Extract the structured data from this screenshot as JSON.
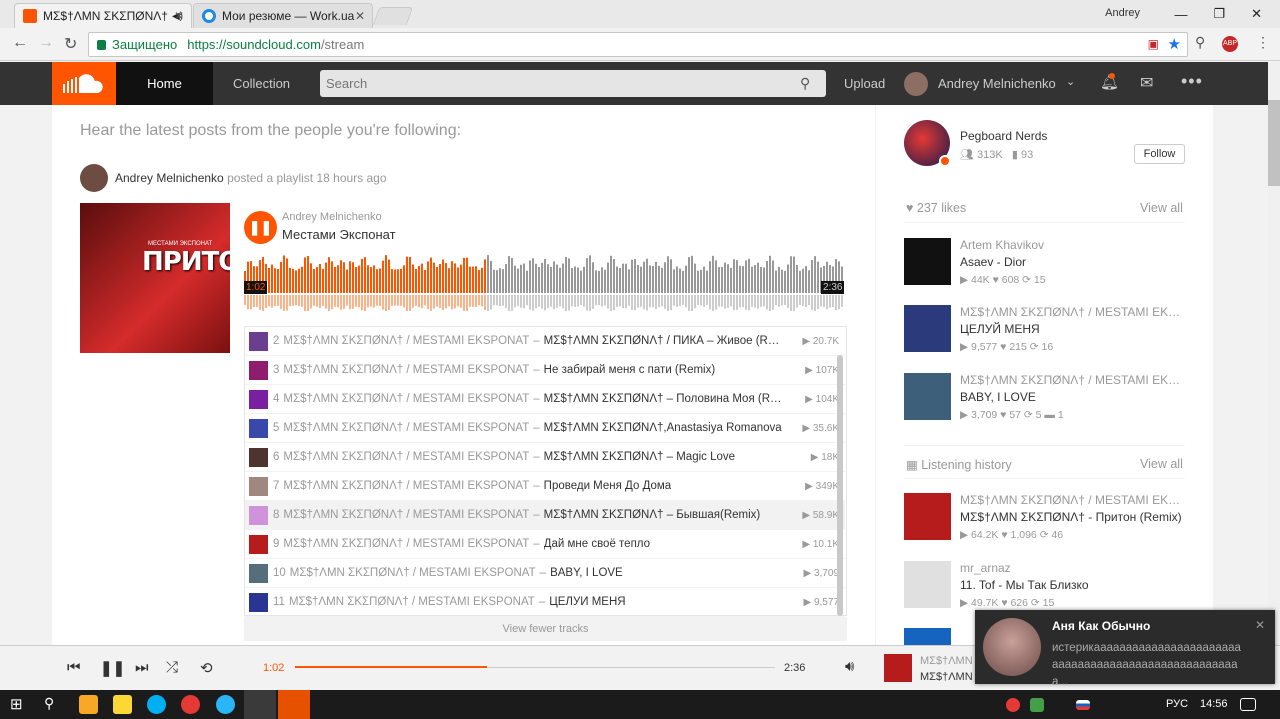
{
  "browser": {
    "tabs": [
      {
        "title": "ΜΣ$†ΛΜΝ ΣΚΣΠØΝΛ†",
        "active": true
      },
      {
        "title": "Мои резюме — Work.ua",
        "active": false
      }
    ],
    "user": "Andrey",
    "secure_label": "Защищено",
    "url_host": "https://soundcloud.com",
    "url_path": "/stream"
  },
  "header": {
    "nav": [
      "Home",
      "Collection"
    ],
    "search_placeholder": "Search",
    "upload": "Upload",
    "username": "Andrey Melnichenko"
  },
  "stream": {
    "intro": "Hear the latest posts from the people you're following:",
    "poster": "Andrey Melnichenko",
    "posted_suffix": "posted a playlist 18 hours ago",
    "playlist": {
      "user": "Andrey Melnichenko",
      "title": "Местами Экспонат",
      "current_time": "1:02",
      "duration": "2:36",
      "progress": 0.4,
      "art_title": "ПРИТОН",
      "art_subtitle": "МЕСТАМИ ЭКСПОНАТ"
    },
    "tracks": [
      {
        "n": "2",
        "artist": "ΜΣ$†ΛΜΝ ΣΚΣΠØΝΛ† / MESTAMI EKSPONAT",
        "title": "ΜΣ$†ΛΜΝ ΣΚΣΠØΝΛ† / ПИКА – Живое (Remix)",
        "plays": "20.7K",
        "color": "#6a3f8f"
      },
      {
        "n": "3",
        "artist": "ΜΣ$†ΛΜΝ ΣΚΣΠØΝΛ† / MESTAMI EKSPONAT",
        "title": "Не забирай меня с пати (Remix)",
        "plays": "107K",
        "color": "#8e1d6e"
      },
      {
        "n": "4",
        "artist": "ΜΣ$†ΛΜΝ ΣΚΣΠØΝΛ† / MESTAMI EKSPONAT",
        "title": "ΜΣ$†ΛΜΝ ΣΚΣΠØΝΛ† – Половина Моя (Remix)",
        "plays": "104K",
        "color": "#7b1fa2"
      },
      {
        "n": "5",
        "artist": "ΜΣ$†ΛΜΝ ΣΚΣΠØΝΛ† / MESTAMI EKSPONAT",
        "title": "ΜΣ$†ΛΜΝ ΣΚΣΠØΝΛ†,Anastasiya Romanova",
        "plays": "35.6K",
        "color": "#3949ab"
      },
      {
        "n": "6",
        "artist": "ΜΣ$†ΛΜΝ ΣΚΣΠØΝΛ† / MESTAMI EKSPONAT",
        "title": "ΜΣ$†ΛΜΝ ΣΚΣΠØΝΛ† – Magic Love",
        "plays": "18K",
        "color": "#4e342e"
      },
      {
        "n": "7",
        "artist": "ΜΣ$†ΛΜΝ ΣΚΣΠØΝΛ† / MESTAMI EKSPONAT",
        "title": "Проведи Меня До Дома",
        "plays": "349K",
        "color": "#a1887f"
      },
      {
        "n": "8",
        "artist": "ΜΣ$†ΛΜΝ ΣΚΣΠØΝΛ† / MESTAMI EKSPONAT",
        "title": "ΜΣ$†ΛΜΝ ΣΚΣΠØΝΛ† – Бывшая(Remix)",
        "plays": "58.9K",
        "color": "#ce93d8"
      },
      {
        "n": "9",
        "artist": "ΜΣ$†ΛΜΝ ΣΚΣΠØΝΛ† / MESTAMI EKSPONAT",
        "title": "Дай мне своё тепло",
        "plays": "10.1K",
        "color": "#b71c1c"
      },
      {
        "n": "10",
        "artist": "ΜΣ$†ΛΜΝ ΣΚΣΠØΝΛ† / MESTAMI EKSPONAT",
        "title": "BABY, I LOVE",
        "plays": "3,709",
        "color": "#546e7a"
      },
      {
        "n": "11",
        "artist": "ΜΣ$†ΛΜΝ ΣΚΣΠØΝΛ† / MESTAMI EKSPONAT",
        "title": "ЦЕЛУЙ МЕНЯ",
        "plays": "9,577",
        "color": "#283593"
      }
    ],
    "view_fewer": "View fewer tracks"
  },
  "sidebar": {
    "suggest": {
      "name": "Pegboard Nerds",
      "followers": "313K",
      "tracks": "93",
      "follow_label": "Follow"
    },
    "likes_header": "237 likes",
    "view_all": "View all",
    "likes": [
      {
        "user": "Artem Khavikov",
        "title": "Asaev - Dior",
        "stats": "▶ 44K   ♥ 608   ⟳ 15",
        "color": "#111"
      },
      {
        "user": "ΜΣ$†ΛΜΝ ΣΚΣΠØΝΛ† / MESTAMI EKSPONAT",
        "title": "ЦЕЛУЙ МЕНЯ",
        "stats": "▶ 9,577   ♥ 215   ⟳ 16",
        "color": "#2a3a7a"
      },
      {
        "user": "ΜΣ$†ΛΜΝ ΣΚΣΠØΝΛ† / MESTAMI EKSPONAT",
        "title": "BABY, I LOVE",
        "stats": "▶ 3,709   ♥ 57   ⟳ 5   ▬ 1",
        "color": "#3e5f7a"
      }
    ],
    "history_header": "Listening history",
    "history": [
      {
        "user": "ΜΣ$†ΛΜΝ ΣΚΣΠØΝΛ† / MESTAMI EKSPONAT",
        "title": "ΜΣ$†ΛΜΝ ΣΚΣΠØΝΛ† - Притон (Remix)",
        "stats": "▶ 64.2K   ♥ 1,096   ⟳ 46",
        "color": "#b71c1c"
      },
      {
        "user": "mr_arnaz",
        "title": "11. Tof - Мы Так Близко",
        "stats": "▶ 49.7K   ♥ 626   ⟳ 15",
        "color": "#e0e0e0"
      }
    ]
  },
  "player": {
    "current": "1:02",
    "duration": "2:36",
    "progress": 0.4,
    "title_line1": "ΜΣ$†ΛΜΝ",
    "title_line2": "ΜΣ$†ΛΜΝ"
  },
  "toast": {
    "title": "Аня Как Обычно",
    "body": "истерикааааааааааааааааааааааааааааааааааааааааааааааааааааа..."
  },
  "taskbar": {
    "lang": "РУС",
    "time": "14:56"
  }
}
